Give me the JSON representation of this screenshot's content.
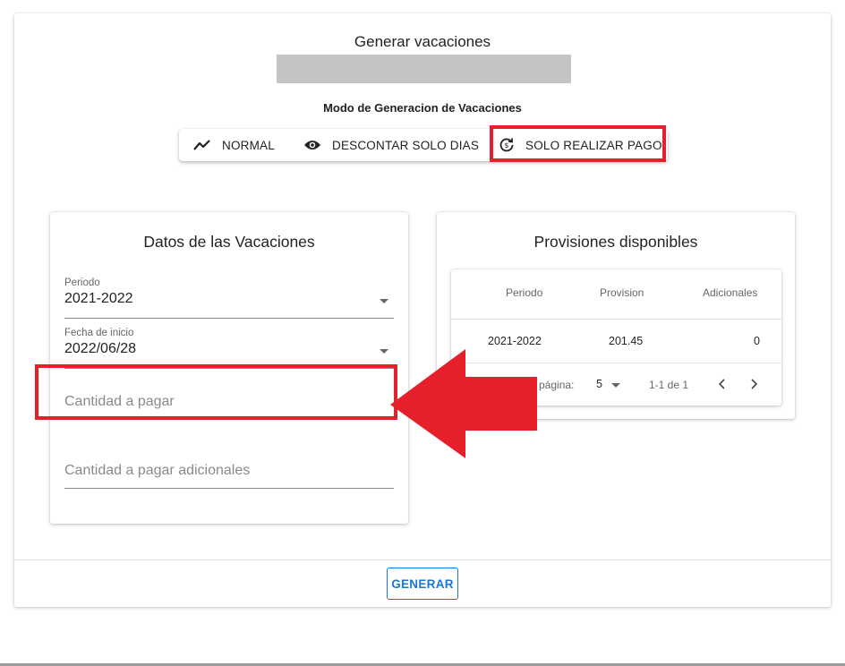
{
  "header": {
    "title": "Generar vacaciones",
    "mode_label": "Modo de Generacion de Vacaciones"
  },
  "modes": {
    "normal": "NORMAL",
    "descontar": "DESCONTAR SOLO DIAS",
    "pago": "SOLO REALIZAR PAGO"
  },
  "datos": {
    "title": "Datos de las Vacaciones",
    "periodo_label": "Periodo",
    "periodo_value": "2021-2022",
    "fecha_label": "Fecha de inicio",
    "fecha_value": "2022/06/28",
    "cantidad_placeholder": "Cantidad a pagar",
    "cantidad_adicionales_placeholder": "Cantidad a pagar adicionales"
  },
  "provisiones": {
    "title": "Provisiones disponibles",
    "columns": [
      "Periodo",
      "Provision",
      "Adicionales"
    ],
    "rows": [
      {
        "periodo": "2021-2022",
        "provision": "201.45",
        "adicionales": "0"
      }
    ],
    "pager": {
      "rows_per_page_label": "página:",
      "rows_per_page": "5",
      "range": "1-1 de 1"
    }
  },
  "footer": {
    "generar_label": "GENERAR"
  },
  "colors": {
    "highlight": "#e5202b",
    "primary": "#1976d2"
  }
}
